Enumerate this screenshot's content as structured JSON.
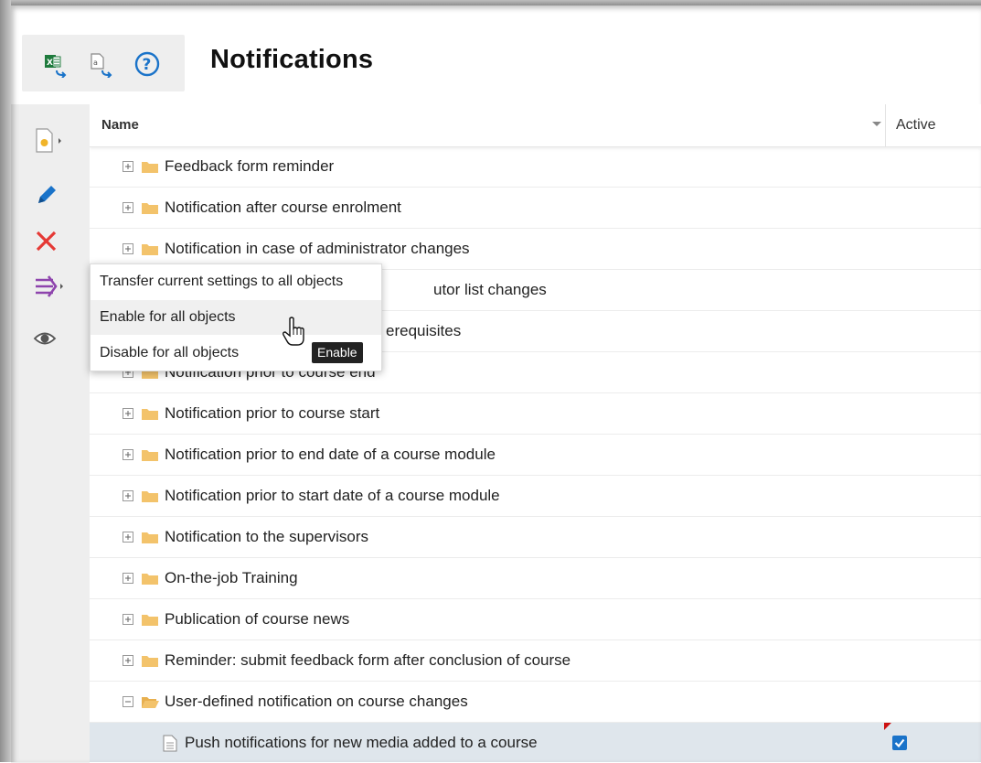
{
  "header": {
    "title": "Notifications",
    "tools": [
      {
        "icon": "excel-export-icon"
      },
      {
        "icon": "document-export-icon"
      },
      {
        "icon": "help-icon"
      }
    ]
  },
  "side_toolbar": [
    {
      "icon": "new-document-icon"
    },
    {
      "icon": "edit-pencil-icon"
    },
    {
      "icon": "delete-x-icon"
    },
    {
      "icon": "transfer-arrow-icon"
    },
    {
      "icon": "view-eye-icon"
    }
  ],
  "grid": {
    "columns": [
      "Name",
      "Active"
    ],
    "rows": [
      {
        "label": "Feedback form reminder"
      },
      {
        "label": "Notification after course enrolment"
      },
      {
        "label": "Notification in case of administrator changes"
      },
      {
        "label": "utor list changes"
      },
      {
        "label": "erequisites"
      },
      {
        "label": "Notification prior to course end"
      },
      {
        "label": "Notification prior to course start"
      },
      {
        "label": "Notification prior to end date of a course module"
      },
      {
        "label": "Notification prior to start date of a course module"
      },
      {
        "label": "Notification to the supervisors"
      },
      {
        "label": "On-the-job Training"
      },
      {
        "label": "Publication of course news"
      },
      {
        "label": "Reminder: submit feedback form after conclusion of course"
      },
      {
        "label": "User-defined notification on course changes"
      },
      {
        "label": "Push notifications for new media added to a course",
        "active": true
      }
    ]
  },
  "context_menu": {
    "items": [
      {
        "label": "Transfer current settings to all objects"
      },
      {
        "label": "Enable for all objects"
      },
      {
        "label": "Disable for all objects"
      }
    ],
    "tooltip": "Enable"
  },
  "colors": {
    "accent_blue": "#1a73c9",
    "folder": "#f3c36b",
    "delete_red": "#e53935",
    "transfer_purple": "#8e44ad",
    "selected_row": "#dfe6ec"
  }
}
